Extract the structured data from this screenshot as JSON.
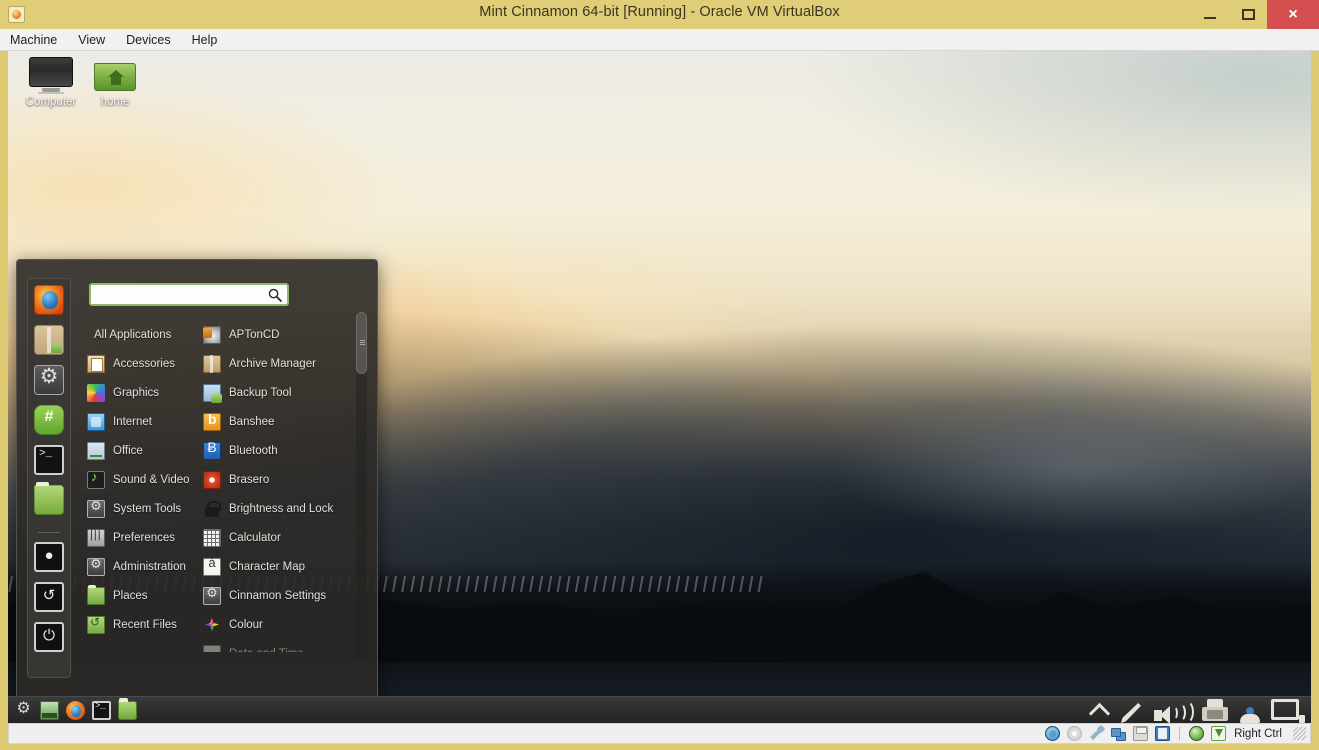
{
  "window": {
    "title": "Mint Cinnamon 64-bit [Running] - Oracle VM VirtualBox",
    "icon": "virtualbox-icon",
    "controls": {
      "minimize": "minimize-button",
      "maximize": "maximize-button",
      "close": "×"
    },
    "accent_titlebar": "#e0cd77",
    "accent_close": "#d45050"
  },
  "menubar": {
    "items": [
      {
        "label": "Machine"
      },
      {
        "label": "View"
      },
      {
        "label": "Devices"
      },
      {
        "label": "Help"
      }
    ]
  },
  "desktop": {
    "icons": [
      {
        "label": "Computer",
        "icon": "computer-icon"
      },
      {
        "label": "home",
        "icon": "home-folder-icon"
      }
    ]
  },
  "cinnamon_menu": {
    "search": {
      "value": "",
      "placeholder": "",
      "icon": "search-icon"
    },
    "favorites": [
      {
        "name": "firefox",
        "tooltip": "Firefox Web Browser"
      },
      {
        "name": "software-manager",
        "tooltip": "Software Manager"
      },
      {
        "name": "system-settings",
        "tooltip": "System Settings"
      },
      {
        "name": "terminal-green",
        "tooltip": "Terminal"
      },
      {
        "name": "terminal",
        "tooltip": "Terminal"
      },
      {
        "name": "files",
        "tooltip": "Files"
      },
      {
        "name": "lock-screen",
        "symbol": "●",
        "tooltip": "Lock Screen"
      },
      {
        "name": "log-out",
        "symbol": "↺",
        "tooltip": "Log Out"
      },
      {
        "name": "quit",
        "symbol": "⏻",
        "tooltip": "Quit"
      }
    ],
    "categories": [
      {
        "label": "All Applications",
        "icon": ""
      },
      {
        "label": "Accessories",
        "icon": "ic-accessories"
      },
      {
        "label": "Graphics",
        "icon": "ic-graphics"
      },
      {
        "label": "Internet",
        "icon": "ic-internet"
      },
      {
        "label": "Office",
        "icon": "ic-office"
      },
      {
        "label": "Sound & Video",
        "icon": "ic-sound"
      },
      {
        "label": "System Tools",
        "icon": "ic-system"
      },
      {
        "label": "Preferences",
        "icon": "ic-prefs"
      },
      {
        "label": "Administration",
        "icon": "ic-admin"
      },
      {
        "label": "Places",
        "icon": "ic-places"
      },
      {
        "label": "Recent Files",
        "icon": "ic-recent"
      }
    ],
    "applications": [
      {
        "label": "APTonCD",
        "icon": "ic-aptoncd",
        "dim": false
      },
      {
        "label": "Archive Manager",
        "icon": "ic-archive",
        "dim": false
      },
      {
        "label": "Backup Tool",
        "icon": "ic-backup",
        "dim": false
      },
      {
        "label": "Banshee",
        "icon": "ic-banshee",
        "dim": false
      },
      {
        "label": "Bluetooth",
        "icon": "ic-bluetooth",
        "dim": false
      },
      {
        "label": "Brasero",
        "icon": "ic-brasero",
        "dim": false
      },
      {
        "label": "Brightness and Lock",
        "icon": "ic-lock",
        "dim": false
      },
      {
        "label": "Calculator",
        "icon": "ic-calc",
        "dim": false
      },
      {
        "label": "Character Map",
        "icon": "ic-charmap",
        "dim": false
      },
      {
        "label": "Cinnamon Settings",
        "icon": "ic-cinnset",
        "dim": false
      },
      {
        "label": "Colour",
        "icon": "ic-colour",
        "dim": false
      },
      {
        "label": "Date and Time",
        "icon": "ic-datetime",
        "dim": true
      }
    ]
  },
  "panel": {
    "launchers": [
      {
        "name": "menu-gear"
      },
      {
        "name": "show-desktop"
      },
      {
        "name": "firefox"
      },
      {
        "name": "terminal"
      },
      {
        "name": "files"
      }
    ],
    "tray": [
      {
        "name": "chevron-up-icon"
      },
      {
        "name": "network-icon"
      },
      {
        "name": "volume-icon"
      },
      {
        "name": "update-manager-icon"
      },
      {
        "name": "user-account-icon"
      },
      {
        "name": "display-icon"
      }
    ]
  },
  "statusbar": {
    "indicators": [
      {
        "name": "hard-disk-icon"
      },
      {
        "name": "optical-disc-icon"
      },
      {
        "name": "floppy-icon"
      },
      {
        "name": "network-adapter-icon"
      },
      {
        "name": "usb-icon"
      },
      {
        "name": "shared-folder-icon"
      },
      {
        "name": "globe-icon"
      },
      {
        "name": "mouse-capture-icon"
      }
    ],
    "host_key": "Right Ctrl"
  }
}
